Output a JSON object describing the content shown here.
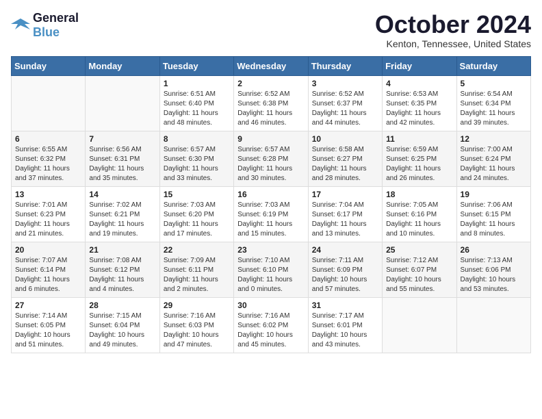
{
  "logo": {
    "line1": "General",
    "line2": "Blue"
  },
  "title": "October 2024",
  "location": "Kenton, Tennessee, United States",
  "weekdays": [
    "Sunday",
    "Monday",
    "Tuesday",
    "Wednesday",
    "Thursday",
    "Friday",
    "Saturday"
  ],
  "weeks": [
    [
      {
        "day": "",
        "info": ""
      },
      {
        "day": "",
        "info": ""
      },
      {
        "day": "1",
        "info": "Sunrise: 6:51 AM\nSunset: 6:40 PM\nDaylight: 11 hours\nand 48 minutes."
      },
      {
        "day": "2",
        "info": "Sunrise: 6:52 AM\nSunset: 6:38 PM\nDaylight: 11 hours\nand 46 minutes."
      },
      {
        "day": "3",
        "info": "Sunrise: 6:52 AM\nSunset: 6:37 PM\nDaylight: 11 hours\nand 44 minutes."
      },
      {
        "day": "4",
        "info": "Sunrise: 6:53 AM\nSunset: 6:35 PM\nDaylight: 11 hours\nand 42 minutes."
      },
      {
        "day": "5",
        "info": "Sunrise: 6:54 AM\nSunset: 6:34 PM\nDaylight: 11 hours\nand 39 minutes."
      }
    ],
    [
      {
        "day": "6",
        "info": "Sunrise: 6:55 AM\nSunset: 6:32 PM\nDaylight: 11 hours\nand 37 minutes."
      },
      {
        "day": "7",
        "info": "Sunrise: 6:56 AM\nSunset: 6:31 PM\nDaylight: 11 hours\nand 35 minutes."
      },
      {
        "day": "8",
        "info": "Sunrise: 6:57 AM\nSunset: 6:30 PM\nDaylight: 11 hours\nand 33 minutes."
      },
      {
        "day": "9",
        "info": "Sunrise: 6:57 AM\nSunset: 6:28 PM\nDaylight: 11 hours\nand 30 minutes."
      },
      {
        "day": "10",
        "info": "Sunrise: 6:58 AM\nSunset: 6:27 PM\nDaylight: 11 hours\nand 28 minutes."
      },
      {
        "day": "11",
        "info": "Sunrise: 6:59 AM\nSunset: 6:25 PM\nDaylight: 11 hours\nand 26 minutes."
      },
      {
        "day": "12",
        "info": "Sunrise: 7:00 AM\nSunset: 6:24 PM\nDaylight: 11 hours\nand 24 minutes."
      }
    ],
    [
      {
        "day": "13",
        "info": "Sunrise: 7:01 AM\nSunset: 6:23 PM\nDaylight: 11 hours\nand 21 minutes."
      },
      {
        "day": "14",
        "info": "Sunrise: 7:02 AM\nSunset: 6:21 PM\nDaylight: 11 hours\nand 19 minutes."
      },
      {
        "day": "15",
        "info": "Sunrise: 7:03 AM\nSunset: 6:20 PM\nDaylight: 11 hours\nand 17 minutes."
      },
      {
        "day": "16",
        "info": "Sunrise: 7:03 AM\nSunset: 6:19 PM\nDaylight: 11 hours\nand 15 minutes."
      },
      {
        "day": "17",
        "info": "Sunrise: 7:04 AM\nSunset: 6:17 PM\nDaylight: 11 hours\nand 13 minutes."
      },
      {
        "day": "18",
        "info": "Sunrise: 7:05 AM\nSunset: 6:16 PM\nDaylight: 11 hours\nand 10 minutes."
      },
      {
        "day": "19",
        "info": "Sunrise: 7:06 AM\nSunset: 6:15 PM\nDaylight: 11 hours\nand 8 minutes."
      }
    ],
    [
      {
        "day": "20",
        "info": "Sunrise: 7:07 AM\nSunset: 6:14 PM\nDaylight: 11 hours\nand 6 minutes."
      },
      {
        "day": "21",
        "info": "Sunrise: 7:08 AM\nSunset: 6:12 PM\nDaylight: 11 hours\nand 4 minutes."
      },
      {
        "day": "22",
        "info": "Sunrise: 7:09 AM\nSunset: 6:11 PM\nDaylight: 11 hours\nand 2 minutes."
      },
      {
        "day": "23",
        "info": "Sunrise: 7:10 AM\nSunset: 6:10 PM\nDaylight: 11 hours\nand 0 minutes."
      },
      {
        "day": "24",
        "info": "Sunrise: 7:11 AM\nSunset: 6:09 PM\nDaylight: 10 hours\nand 57 minutes."
      },
      {
        "day": "25",
        "info": "Sunrise: 7:12 AM\nSunset: 6:07 PM\nDaylight: 10 hours\nand 55 minutes."
      },
      {
        "day": "26",
        "info": "Sunrise: 7:13 AM\nSunset: 6:06 PM\nDaylight: 10 hours\nand 53 minutes."
      }
    ],
    [
      {
        "day": "27",
        "info": "Sunrise: 7:14 AM\nSunset: 6:05 PM\nDaylight: 10 hours\nand 51 minutes."
      },
      {
        "day": "28",
        "info": "Sunrise: 7:15 AM\nSunset: 6:04 PM\nDaylight: 10 hours\nand 49 minutes."
      },
      {
        "day": "29",
        "info": "Sunrise: 7:16 AM\nSunset: 6:03 PM\nDaylight: 10 hours\nand 47 minutes."
      },
      {
        "day": "30",
        "info": "Sunrise: 7:16 AM\nSunset: 6:02 PM\nDaylight: 10 hours\nand 45 minutes."
      },
      {
        "day": "31",
        "info": "Sunrise: 7:17 AM\nSunset: 6:01 PM\nDaylight: 10 hours\nand 43 minutes."
      },
      {
        "day": "",
        "info": ""
      },
      {
        "day": "",
        "info": ""
      }
    ]
  ]
}
